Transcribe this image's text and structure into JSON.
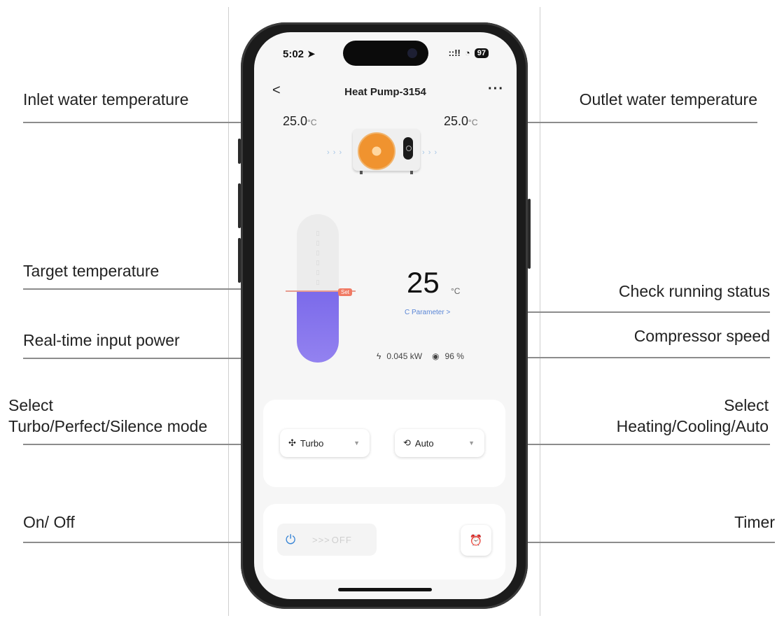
{
  "annotations": {
    "inlet": "Inlet water temperature",
    "outlet": "Outlet water temperature",
    "target": "Target temperature",
    "status": "Check running status",
    "power": "Real-time input power",
    "compressor": "Compressor speed",
    "mode_line1": "Select",
    "mode_line2": "Turbo/Perfect/Silence mode",
    "work_line1": "Select",
    "work_line2": "Heating/Cooling/Auto",
    "onoff": "On/ Off",
    "timer": "Timer"
  },
  "status_bar": {
    "time": "5:02",
    "signal": "::!!",
    "battery": "97"
  },
  "header": {
    "back": "<",
    "title": "Heat Pump-3154",
    "more": "···"
  },
  "inlet_temp": {
    "value": "25.0",
    "unit": "°C"
  },
  "outlet_temp": {
    "value": "25.0",
    "unit": "°C"
  },
  "target": {
    "value": "25",
    "unit": "°C",
    "set_badge": "Set",
    "fill_fraction": 0.48
  },
  "parameter_link": "C Parameter >",
  "stats": {
    "power": "0.045 kW",
    "compressor": "96 %"
  },
  "mode_dropdown": {
    "icon": "fan-icon",
    "label": "Turbo"
  },
  "work_dropdown": {
    "icon": "auto-mode-icon",
    "label": "Auto"
  },
  "power_toggle": {
    "state_text": "OFF",
    "arrows": ">>>"
  },
  "colors": {
    "accent_blue": "#3a86d6",
    "fill_purple": "#8574ee",
    "set_red": "#f07a64"
  }
}
